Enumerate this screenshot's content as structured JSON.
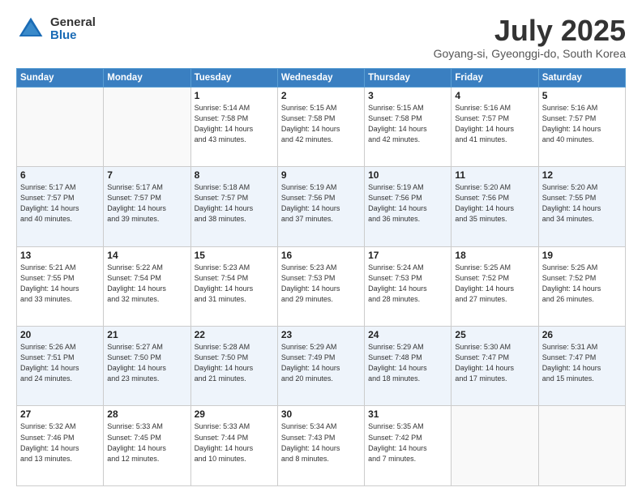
{
  "header": {
    "logo_general": "General",
    "logo_blue": "Blue",
    "month_title": "July 2025",
    "location": "Goyang-si, Gyeonggi-do, South Korea"
  },
  "days_of_week": [
    "Sunday",
    "Monday",
    "Tuesday",
    "Wednesday",
    "Thursday",
    "Friday",
    "Saturday"
  ],
  "weeks": [
    [
      {
        "day": "",
        "info": ""
      },
      {
        "day": "",
        "info": ""
      },
      {
        "day": "1",
        "info": "Sunrise: 5:14 AM\nSunset: 7:58 PM\nDaylight: 14 hours\nand 43 minutes."
      },
      {
        "day": "2",
        "info": "Sunrise: 5:15 AM\nSunset: 7:58 PM\nDaylight: 14 hours\nand 42 minutes."
      },
      {
        "day": "3",
        "info": "Sunrise: 5:15 AM\nSunset: 7:58 PM\nDaylight: 14 hours\nand 42 minutes."
      },
      {
        "day": "4",
        "info": "Sunrise: 5:16 AM\nSunset: 7:57 PM\nDaylight: 14 hours\nand 41 minutes."
      },
      {
        "day": "5",
        "info": "Sunrise: 5:16 AM\nSunset: 7:57 PM\nDaylight: 14 hours\nand 40 minutes."
      }
    ],
    [
      {
        "day": "6",
        "info": "Sunrise: 5:17 AM\nSunset: 7:57 PM\nDaylight: 14 hours\nand 40 minutes."
      },
      {
        "day": "7",
        "info": "Sunrise: 5:17 AM\nSunset: 7:57 PM\nDaylight: 14 hours\nand 39 minutes."
      },
      {
        "day": "8",
        "info": "Sunrise: 5:18 AM\nSunset: 7:57 PM\nDaylight: 14 hours\nand 38 minutes."
      },
      {
        "day": "9",
        "info": "Sunrise: 5:19 AM\nSunset: 7:56 PM\nDaylight: 14 hours\nand 37 minutes."
      },
      {
        "day": "10",
        "info": "Sunrise: 5:19 AM\nSunset: 7:56 PM\nDaylight: 14 hours\nand 36 minutes."
      },
      {
        "day": "11",
        "info": "Sunrise: 5:20 AM\nSunset: 7:56 PM\nDaylight: 14 hours\nand 35 minutes."
      },
      {
        "day": "12",
        "info": "Sunrise: 5:20 AM\nSunset: 7:55 PM\nDaylight: 14 hours\nand 34 minutes."
      }
    ],
    [
      {
        "day": "13",
        "info": "Sunrise: 5:21 AM\nSunset: 7:55 PM\nDaylight: 14 hours\nand 33 minutes."
      },
      {
        "day": "14",
        "info": "Sunrise: 5:22 AM\nSunset: 7:54 PM\nDaylight: 14 hours\nand 32 minutes."
      },
      {
        "day": "15",
        "info": "Sunrise: 5:23 AM\nSunset: 7:54 PM\nDaylight: 14 hours\nand 31 minutes."
      },
      {
        "day": "16",
        "info": "Sunrise: 5:23 AM\nSunset: 7:53 PM\nDaylight: 14 hours\nand 29 minutes."
      },
      {
        "day": "17",
        "info": "Sunrise: 5:24 AM\nSunset: 7:53 PM\nDaylight: 14 hours\nand 28 minutes."
      },
      {
        "day": "18",
        "info": "Sunrise: 5:25 AM\nSunset: 7:52 PM\nDaylight: 14 hours\nand 27 minutes."
      },
      {
        "day": "19",
        "info": "Sunrise: 5:25 AM\nSunset: 7:52 PM\nDaylight: 14 hours\nand 26 minutes."
      }
    ],
    [
      {
        "day": "20",
        "info": "Sunrise: 5:26 AM\nSunset: 7:51 PM\nDaylight: 14 hours\nand 24 minutes."
      },
      {
        "day": "21",
        "info": "Sunrise: 5:27 AM\nSunset: 7:50 PM\nDaylight: 14 hours\nand 23 minutes."
      },
      {
        "day": "22",
        "info": "Sunrise: 5:28 AM\nSunset: 7:50 PM\nDaylight: 14 hours\nand 21 minutes."
      },
      {
        "day": "23",
        "info": "Sunrise: 5:29 AM\nSunset: 7:49 PM\nDaylight: 14 hours\nand 20 minutes."
      },
      {
        "day": "24",
        "info": "Sunrise: 5:29 AM\nSunset: 7:48 PM\nDaylight: 14 hours\nand 18 minutes."
      },
      {
        "day": "25",
        "info": "Sunrise: 5:30 AM\nSunset: 7:47 PM\nDaylight: 14 hours\nand 17 minutes."
      },
      {
        "day": "26",
        "info": "Sunrise: 5:31 AM\nSunset: 7:47 PM\nDaylight: 14 hours\nand 15 minutes."
      }
    ],
    [
      {
        "day": "27",
        "info": "Sunrise: 5:32 AM\nSunset: 7:46 PM\nDaylight: 14 hours\nand 13 minutes."
      },
      {
        "day": "28",
        "info": "Sunrise: 5:33 AM\nSunset: 7:45 PM\nDaylight: 14 hours\nand 12 minutes."
      },
      {
        "day": "29",
        "info": "Sunrise: 5:33 AM\nSunset: 7:44 PM\nDaylight: 14 hours\nand 10 minutes."
      },
      {
        "day": "30",
        "info": "Sunrise: 5:34 AM\nSunset: 7:43 PM\nDaylight: 14 hours\nand 8 minutes."
      },
      {
        "day": "31",
        "info": "Sunrise: 5:35 AM\nSunset: 7:42 PM\nDaylight: 14 hours\nand 7 minutes."
      },
      {
        "day": "",
        "info": ""
      },
      {
        "day": "",
        "info": ""
      }
    ]
  ]
}
